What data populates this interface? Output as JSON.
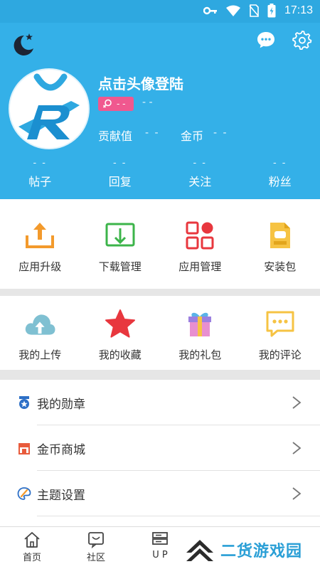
{
  "status_bar": {
    "time": "17:13"
  },
  "profile": {
    "login_prompt": "点击头像登陆",
    "gender_value": "- -",
    "level_value": "- -",
    "contribution_label": "贡献值",
    "contribution_value": "- -",
    "coins_label": "金币",
    "coins_value": "- -"
  },
  "counts": [
    {
      "value": "- -",
      "label": "帖子"
    },
    {
      "value": "- -",
      "label": "回复"
    },
    {
      "value": "- -",
      "label": "关注"
    },
    {
      "value": "- -",
      "label": "粉丝"
    }
  ],
  "grid_primary": [
    {
      "label": "应用升级",
      "icon": "upload-tray-icon"
    },
    {
      "label": "下载管理",
      "icon": "download-tray-icon"
    },
    {
      "label": "应用管理",
      "icon": "apps-grid-icon"
    },
    {
      "label": "安装包",
      "icon": "apk-file-icon"
    }
  ],
  "grid_secondary": [
    {
      "label": "我的上传",
      "icon": "cloud-upload-icon"
    },
    {
      "label": "我的收藏",
      "icon": "star-icon"
    },
    {
      "label": "我的礼包",
      "icon": "gift-icon"
    },
    {
      "label": "我的评论",
      "icon": "comment-icon"
    }
  ],
  "menu_list": [
    {
      "label": "我的勋章",
      "icon": "medal-icon"
    },
    {
      "label": "金币商城",
      "icon": "shop-icon"
    },
    {
      "label": "主题设置",
      "icon": "palette-icon"
    }
  ],
  "bottom_nav": [
    {
      "label": "首页",
      "icon": "home-icon"
    },
    {
      "label": "社区",
      "icon": "community-icon"
    },
    {
      "label": "U P",
      "icon": "up-icon"
    }
  ],
  "watermark": {
    "text": "二货游戏园"
  },
  "colors": {
    "header": "#34b0e8",
    "accent_pink": "#f0588f",
    "orange": "#f39a2c",
    "green": "#3cb44a",
    "red": "#e8373e"
  }
}
